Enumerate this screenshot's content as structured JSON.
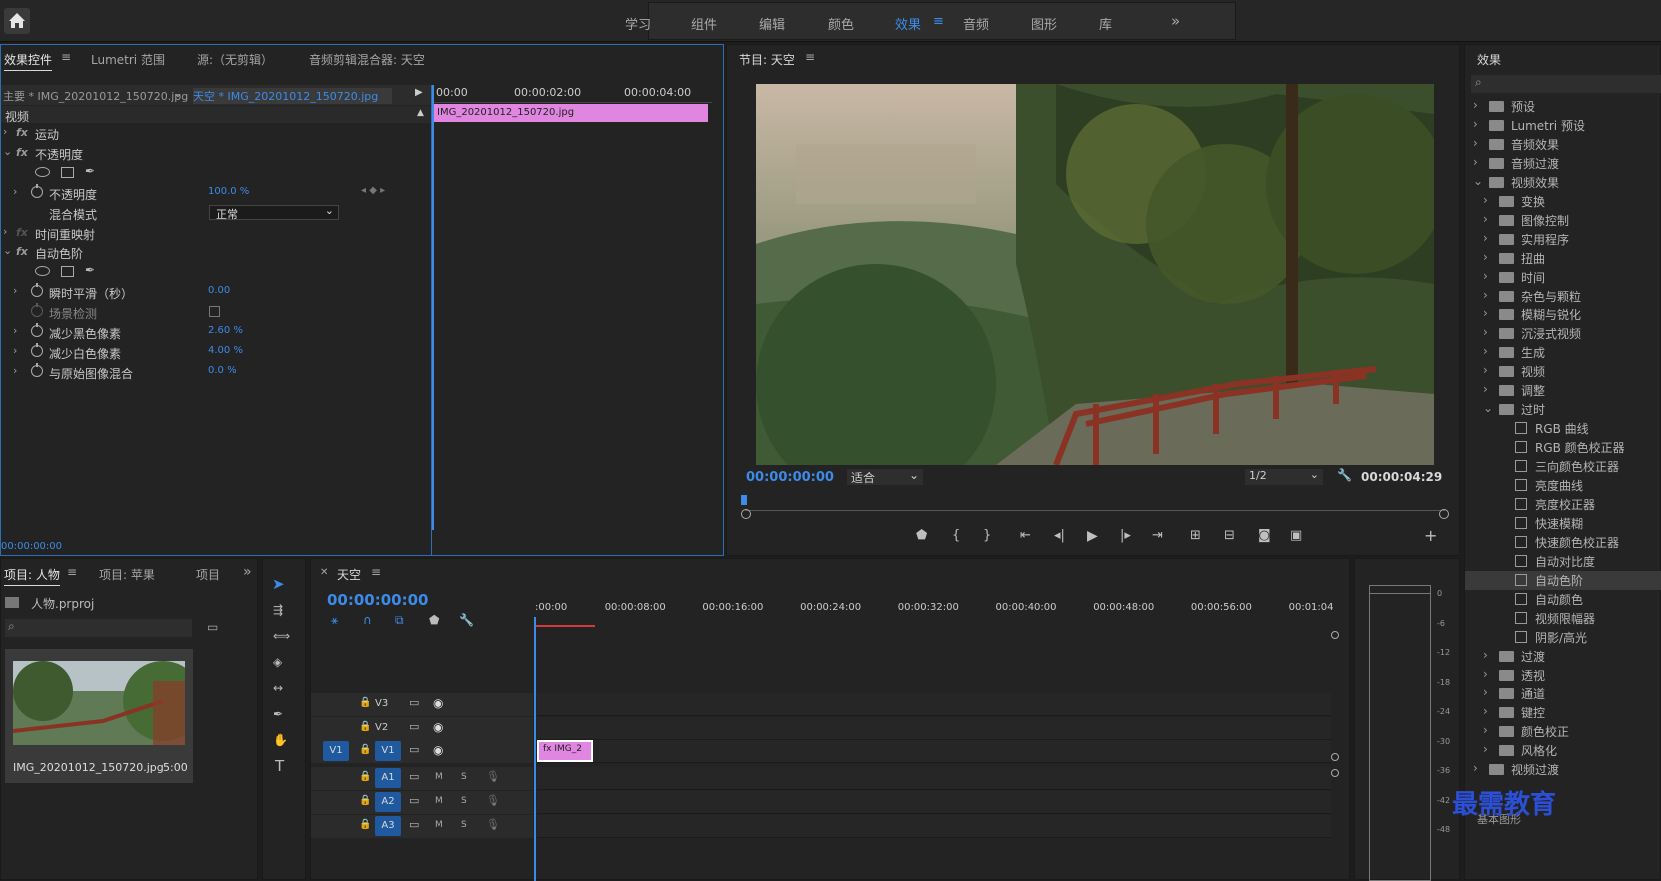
{
  "topbar": {
    "tabs": [
      "学习",
      "组件",
      "编辑",
      "颜色",
      "效果",
      "音频",
      "图形",
      "库"
    ],
    "active": "效果",
    "more": "»"
  },
  "effect_controls": {
    "tabs": [
      "效果控件",
      "Lumetri 范围",
      "源:（无剪辑）",
      "音频剪辑混合器: 天空"
    ],
    "master": "主要 * IMG_20201012_150720.jpg",
    "seq": "天空 * IMG_20201012_150720.jpg",
    "ruler": [
      "00:00",
      "00:00:02:00",
      "00:00:04:00"
    ],
    "clip": "IMG_20201012_150720.jpg",
    "section": "视频",
    "rows": [
      {
        "type": "fx",
        "label": "运动"
      },
      {
        "type": "fx",
        "label": "不透明度",
        "open": true
      },
      {
        "type": "shapes"
      },
      {
        "type": "prop",
        "label": "不透明度",
        "value": "100.0 %",
        "kf": true
      },
      {
        "type": "prop2",
        "label": "混合模式",
        "select": "正常"
      },
      {
        "type": "fxoff",
        "label": "时间重映射"
      },
      {
        "type": "fx",
        "label": "自动色阶",
        "open": true
      },
      {
        "type": "shapes"
      },
      {
        "type": "prop",
        "label": "瞬时平滑（秒）",
        "value": "0.00"
      },
      {
        "type": "check",
        "label": "场景检测"
      },
      {
        "type": "prop",
        "label": "减少黑色像素",
        "value": "2.60 %"
      },
      {
        "type": "prop",
        "label": "减少白色像素",
        "value": "4.00 %"
      },
      {
        "type": "prop",
        "label": "与原始图像混合",
        "value": "0.0 %"
      }
    ],
    "timecode": "00:00:00:00"
  },
  "program": {
    "title": "节目: 天空",
    "timecode": "00:00:00:00",
    "fit": "适合",
    "res": "1/2",
    "duration": "00:00:04:29"
  },
  "effects": {
    "title": "效果",
    "items": [
      {
        "t": "f",
        "l": "预设",
        "d": 0
      },
      {
        "t": "f",
        "l": "Lumetri 预设",
        "d": 0
      },
      {
        "t": "f",
        "l": "音频效果",
        "d": 0
      },
      {
        "t": "f",
        "l": "音频过渡",
        "d": 0
      },
      {
        "t": "f",
        "l": "视频效果",
        "d": 0,
        "open": true
      },
      {
        "t": "f",
        "l": "变换",
        "d": 1
      },
      {
        "t": "f",
        "l": "图像控制",
        "d": 1
      },
      {
        "t": "f",
        "l": "实用程序",
        "d": 1
      },
      {
        "t": "f",
        "l": "扭曲",
        "d": 1
      },
      {
        "t": "f",
        "l": "时间",
        "d": 1
      },
      {
        "t": "f",
        "l": "杂色与颗粒",
        "d": 1
      },
      {
        "t": "f",
        "l": "模糊与锐化",
        "d": 1
      },
      {
        "t": "f",
        "l": "沉浸式视频",
        "d": 1
      },
      {
        "t": "f",
        "l": "生成",
        "d": 1
      },
      {
        "t": "f",
        "l": "视频",
        "d": 1
      },
      {
        "t": "f",
        "l": "调整",
        "d": 1
      },
      {
        "t": "f",
        "l": "过时",
        "d": 1,
        "open": true
      },
      {
        "t": "e",
        "l": "RGB 曲线",
        "d": 2
      },
      {
        "t": "e",
        "l": "RGB 颜色校正器",
        "d": 2
      },
      {
        "t": "e",
        "l": "三向颜色校正器",
        "d": 2
      },
      {
        "t": "e",
        "l": "亮度曲线",
        "d": 2
      },
      {
        "t": "e",
        "l": "亮度校正器",
        "d": 2
      },
      {
        "t": "e",
        "l": "快速模糊",
        "d": 2
      },
      {
        "t": "e",
        "l": "快速颜色校正器",
        "d": 2
      },
      {
        "t": "e",
        "l": "自动对比度",
        "d": 2
      },
      {
        "t": "e",
        "l": "自动色阶",
        "d": 2,
        "sel": true
      },
      {
        "t": "e",
        "l": "自动颜色",
        "d": 2
      },
      {
        "t": "e",
        "l": "视频限幅器",
        "d": 2
      },
      {
        "t": "e",
        "l": "阴影/高光",
        "d": 2
      },
      {
        "t": "f",
        "l": "过渡",
        "d": 1
      },
      {
        "t": "f",
        "l": "透视",
        "d": 1
      },
      {
        "t": "f",
        "l": "通道",
        "d": 1
      },
      {
        "t": "f",
        "l": "键控",
        "d": 1
      },
      {
        "t": "f",
        "l": "颜色校正",
        "d": 1
      },
      {
        "t": "f",
        "l": "风格化",
        "d": 1
      },
      {
        "t": "f",
        "l": "视频过渡",
        "d": 0
      }
    ],
    "footer": "基本图形"
  },
  "project": {
    "tabs": [
      "项目: 人物",
      "项目: 苹果",
      "项目"
    ],
    "file": "人物.prproj",
    "clip": "IMG_20201012_150720.jpg",
    "dur": "5:00"
  },
  "timeline": {
    "title": "天空",
    "timecode": "00:00:00:00",
    "ruler": [
      ":00:00",
      "00:00:08:00",
      "00:00:16:00",
      "00:00:24:00",
      "00:00:32:00",
      "00:00:40:00",
      "00:00:48:00",
      "00:00:56:00",
      "00:01:04"
    ],
    "tracks": [
      "V3",
      "V2",
      "V1",
      "A1",
      "A2",
      "A3"
    ],
    "src": "V1",
    "clip": "IMG_2"
  },
  "meter": {
    "ticks": [
      "0",
      "-6",
      "-12",
      "-18",
      "-24",
      "-30",
      "-36",
      "-42",
      "-48"
    ]
  },
  "watermark": "最需教育"
}
